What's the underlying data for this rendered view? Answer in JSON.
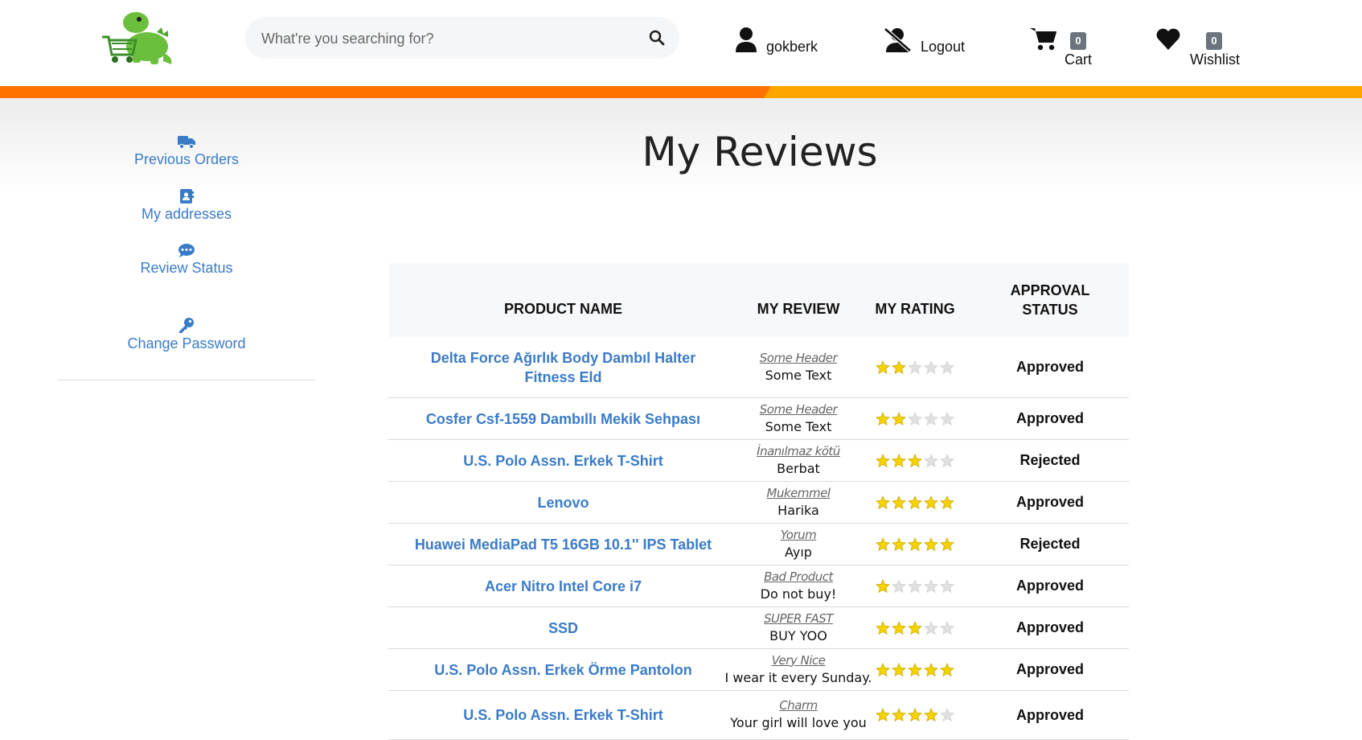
{
  "header": {
    "search_placeholder": "What're you searching for?",
    "user_label": "gokberk",
    "logout_label": "Logout",
    "cart_label": "Cart",
    "cart_count": "0",
    "wishlist_label": "Wishlist",
    "wishlist_count": "0"
  },
  "sidebar": {
    "items": [
      {
        "label": "Previous Orders",
        "icon": "truck-icon"
      },
      {
        "label": "My addresses",
        "icon": "address-book-icon"
      },
      {
        "label": "Review Status",
        "icon": "comment-dots-icon"
      },
      {
        "label": "Change Password",
        "icon": "key-icon"
      }
    ]
  },
  "page": {
    "title": "My Reviews"
  },
  "table": {
    "headers": {
      "product": "PRODUCT NAME",
      "review": "MY REVIEW",
      "rating": "MY RATING",
      "status_line1": "APPROVAL",
      "status_line2": "STATUS"
    },
    "rows": [
      {
        "product": "Delta Force Ağırlık Body Dambıl Halter Fitness Eld",
        "header": "Some Header",
        "text": "Some Text",
        "rating": 2,
        "status": "Approved"
      },
      {
        "product": "Cosfer Csf-1559 Dambıllı Mekik Sehpası",
        "header": "Some Header",
        "text": "Some Text",
        "rating": 2,
        "status": "Approved"
      },
      {
        "product": "U.S. Polo Assn. Erkek T-Shirt",
        "header": "İnanılmaz kötü",
        "text": "Berbat",
        "rating": 3,
        "status": "Rejected"
      },
      {
        "product": "Lenovo",
        "header": "Mukemmel",
        "text": "Harika",
        "rating": 5,
        "status": "Approved"
      },
      {
        "product": "Huawei MediaPad T5 16GB 10.1'' IPS Tablet",
        "header": "Yorum",
        "text": "Ayıp",
        "rating": 5,
        "status": "Rejected"
      },
      {
        "product": "Acer Nitro Intel Core i7",
        "header": "Bad Product",
        "text": "Do not buy!",
        "rating": 1,
        "status": "Approved"
      },
      {
        "product": "SSD",
        "header": "SUPER FAST",
        "text": "BUY YOO",
        "rating": 3,
        "status": "Approved"
      },
      {
        "product": "U.S. Polo Assn. Erkek Örme Pantolon",
        "header": "Very Nice",
        "text": "I wear it every Sunday.",
        "rating": 5,
        "status": "Approved"
      },
      {
        "product": "U.S. Polo Assn. Erkek T-Shirt",
        "header": "Charm",
        "text": "Your girl will love you",
        "rating": 4,
        "status": "Approved"
      }
    ]
  },
  "colors": {
    "accent_orange": "#ff7200",
    "accent_yellow": "#ffa500",
    "link_blue": "#3a7bc8",
    "star": "#f5d300"
  }
}
